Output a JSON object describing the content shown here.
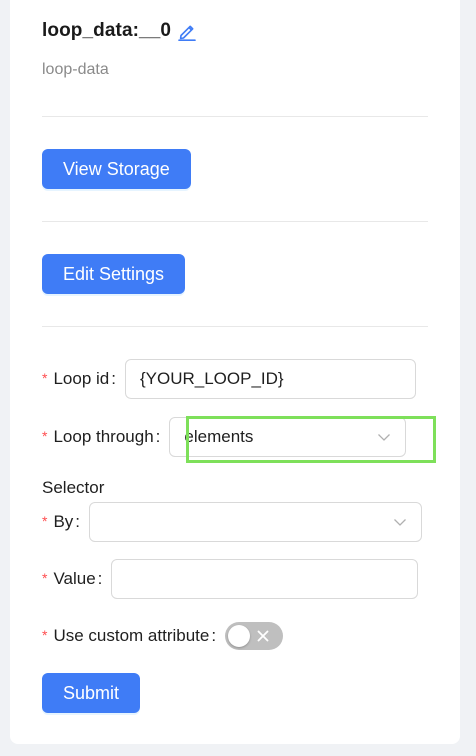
{
  "header": {
    "title": "loop_data:__0",
    "subtitle": "loop-data"
  },
  "buttons": {
    "view_storage": "View Storage",
    "edit_settings": "Edit Settings",
    "submit": "Submit"
  },
  "form": {
    "required_mark": "*",
    "colon": ":",
    "loop_id": {
      "label": "Loop id",
      "value": "{YOUR_LOOP_ID}"
    },
    "loop_through": {
      "label": "Loop through",
      "value": "elements"
    },
    "selector": {
      "section_label": "Selector",
      "by": {
        "label": "By",
        "value": ""
      },
      "value": {
        "label": "Value",
        "value": ""
      }
    },
    "use_custom_attribute": {
      "label": "Use custom attribute",
      "checked": false
    }
  },
  "colors": {
    "primary": "#3f7cf6",
    "required": "#ff4d4f",
    "highlight": "#7ee05a",
    "switch_off": "#bfbfbf"
  },
  "icons": {
    "title_edit": "edit-pencil-icon",
    "select_arrow": "chevron-down-icon",
    "switch_off": "close-icon"
  }
}
